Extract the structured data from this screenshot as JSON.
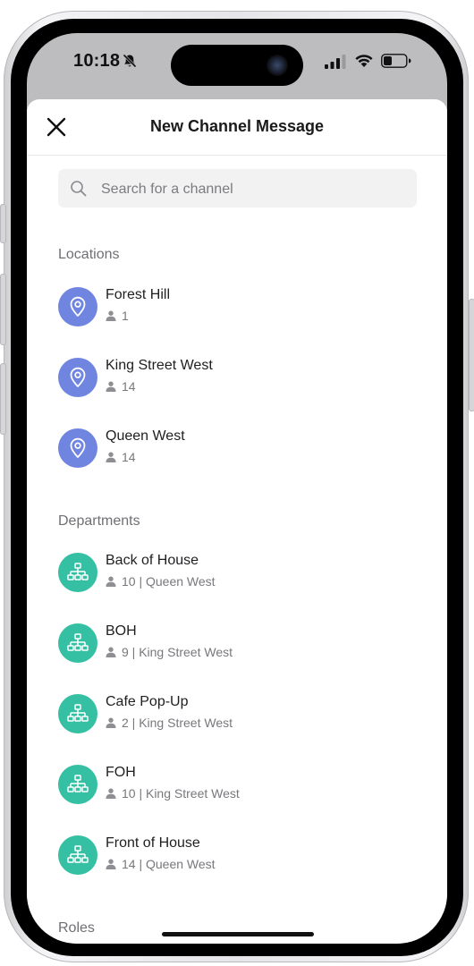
{
  "status": {
    "time": "10:18"
  },
  "header": {
    "title": "New Channel Message"
  },
  "search": {
    "placeholder": "Search for a channel"
  },
  "sections": {
    "locations": "Locations",
    "departments": "Departments",
    "roles": "Roles"
  },
  "locations": [
    {
      "name": "Forest Hill",
      "meta": "1"
    },
    {
      "name": "King Street West",
      "meta": "14"
    },
    {
      "name": "Queen West",
      "meta": "14"
    }
  ],
  "departments": [
    {
      "name": "Back of House",
      "meta": "10 | Queen West"
    },
    {
      "name": "BOH",
      "meta": "9 | King Street West"
    },
    {
      "name": "Cafe Pop-Up",
      "meta": "2 | King Street West"
    },
    {
      "name": "FOH",
      "meta": "10 | King Street West"
    },
    {
      "name": "Front of House",
      "meta": "14 | Queen West"
    }
  ],
  "colors": {
    "location_accent": "#6f85e0",
    "department_accent": "#35c0a3"
  }
}
